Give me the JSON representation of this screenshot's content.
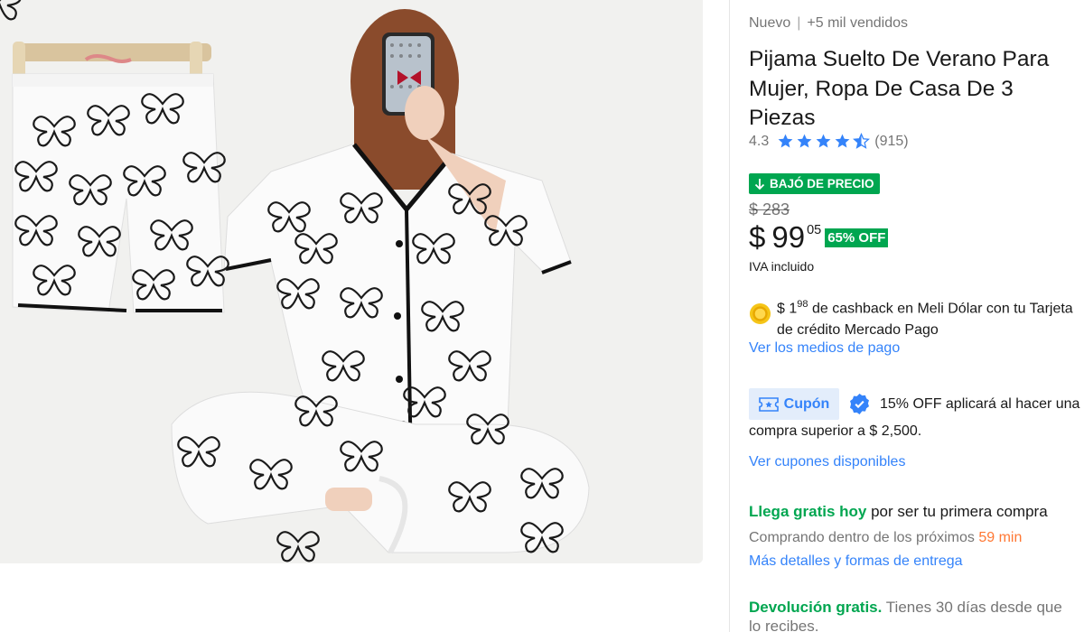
{
  "product": {
    "condition": "Nuevo",
    "sold": "+5 mil vendidos",
    "title": "Pijama Suelto De Verano Para Mujer, Ropa De Casa De 3 Piezas",
    "rating_value": "4.3",
    "rating": 4.3,
    "reviews": "(915)",
    "image_alt": "Pijama blanco con estampado de mariposas negras"
  },
  "pricing": {
    "badge": "BAJÓ DE PRECIO",
    "old_price": "$ 283",
    "currency": "$",
    "price_int": "99",
    "price_cents": "05",
    "discount": "65% OFF",
    "tax_note": "IVA incluido"
  },
  "cashback": {
    "amount": "$ 1",
    "amount_cents": "98",
    "text_line1": " de cashback en Meli Dólar con tu Tarjeta",
    "text_line2": "de crédito Mercado Pago",
    "payment_link": "Ver los medios de pago"
  },
  "coupon": {
    "button": "Cupón",
    "text_line1": "15% OFF aplicará al hacer una",
    "text_line2": "compra superior a $ 2,500.",
    "link": "Ver cupones disponibles"
  },
  "shipping": {
    "highlight": "Llega gratis hoy",
    "rest": " por ser tu primera compra",
    "countdown_prefix": "Comprando dentro de los próximos ",
    "countdown": "59 min",
    "link": "Más detalles y formas de entrega"
  },
  "returns": {
    "highlight": "Devolución gratis.",
    "rest": " Tienes 30 días desde que",
    "line2": "lo recibes."
  },
  "colors": {
    "accent": "#3483fa",
    "green": "#00a650",
    "orange": "#ff7733",
    "star": "#3483fa"
  },
  "icons": [
    "arrow-down-icon",
    "star-icon",
    "star-half-icon",
    "coin-icon",
    "coupon-icon",
    "verified-check-icon"
  ]
}
